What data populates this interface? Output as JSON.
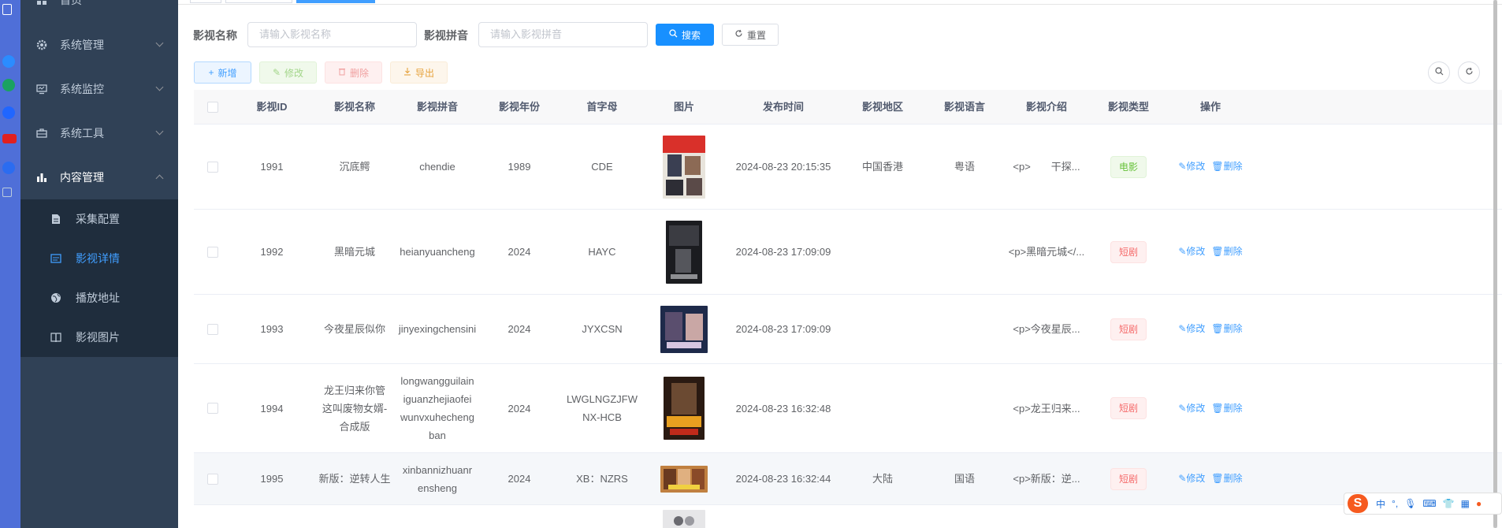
{
  "sidebar": {
    "items": [
      {
        "label": "首页",
        "icon": "dashboard-icon"
      },
      {
        "label": "系统管理",
        "icon": "gear-icon"
      },
      {
        "label": "系统监控",
        "icon": "monitor-icon"
      },
      {
        "label": "系统工具",
        "icon": "toolbox-icon"
      },
      {
        "label": "内容管理",
        "icon": "chart-bar-icon"
      }
    ],
    "subitems": [
      {
        "label": "采集配置",
        "icon": "document-icon"
      },
      {
        "label": "影视详情",
        "icon": "picture-icon"
      },
      {
        "label": "播放地址",
        "icon": "globe-icon"
      },
      {
        "label": "影视图片",
        "icon": "book-icon"
      }
    ]
  },
  "search": {
    "name_label": "影视名称",
    "name_placeholder": "请输入影视名称",
    "pinyin_label": "影视拼音",
    "pinyin_placeholder": "请输入影视拼音",
    "search_btn": "搜索",
    "reset_btn": "重置"
  },
  "toolbar": {
    "add": "新增",
    "edit": "修改",
    "delete": "删除",
    "export": "导出"
  },
  "table": {
    "headers": [
      "影视ID",
      "影视名称",
      "影视拼音",
      "影视年份",
      "首字母",
      "图片",
      "发布时间",
      "影视地区",
      "影视语言",
      "影视介绍",
      "影视类型",
      "操作"
    ],
    "rows": [
      {
        "id": "1991",
        "name": "沉底鳄",
        "pinyin": "chendie",
        "year": "1989",
        "initial": "CDE",
        "time": "2024-08-23 20:15:35",
        "region": "中国香港",
        "lang": "粤语",
        "intro": "<p>　　干探...",
        "type": "电影",
        "type_kind": "movie"
      },
      {
        "id": "1992",
        "name": "黑暗元城",
        "pinyin": "heianyuancheng",
        "year": "2024",
        "initial": "HAYC",
        "time": "2024-08-23 17:09:09",
        "region": "",
        "lang": "",
        "intro": "<p>黑暗元城</...",
        "type": "短剧",
        "type_kind": "short"
      },
      {
        "id": "1993",
        "name": "今夜星辰似你",
        "pinyin": "jinyexingchensini",
        "year": "2024",
        "initial": "JYXCSN",
        "time": "2024-08-23 17:09:09",
        "region": "",
        "lang": "",
        "intro": "<p>今夜星辰...",
        "type": "短剧",
        "type_kind": "short"
      },
      {
        "id": "1994",
        "name": "龙王归来你管这叫废物女婿-合成版",
        "pinyin": "longwangguilainiguanzhejiaofeiwunvxuhechengban",
        "year": "2024",
        "initial": "LWGLNGZJFWNX-HCB",
        "time": "2024-08-23 16:32:48",
        "region": "",
        "lang": "",
        "intro": "<p>龙王归来...",
        "type": "短剧",
        "type_kind": "short"
      },
      {
        "id": "1995",
        "name": "新版：逆转人生",
        "pinyin": "xinbannizhuanrensheng",
        "year": "2024",
        "initial": "XB：NZRS",
        "time": "2024-08-23 16:32:44",
        "region": "大陆",
        "lang": "国语",
        "intro": "<p>新版：逆...",
        "type": "短剧",
        "type_kind": "short"
      }
    ],
    "row_actions": {
      "edit": "修改",
      "delete": "删除"
    }
  },
  "ime": {
    "lang": "中",
    "punct": "°,"
  },
  "colors": {
    "primary": "#1890ff",
    "sidebar": "#304156",
    "submenu": "#1f2d3d",
    "active": "#409eff"
  }
}
